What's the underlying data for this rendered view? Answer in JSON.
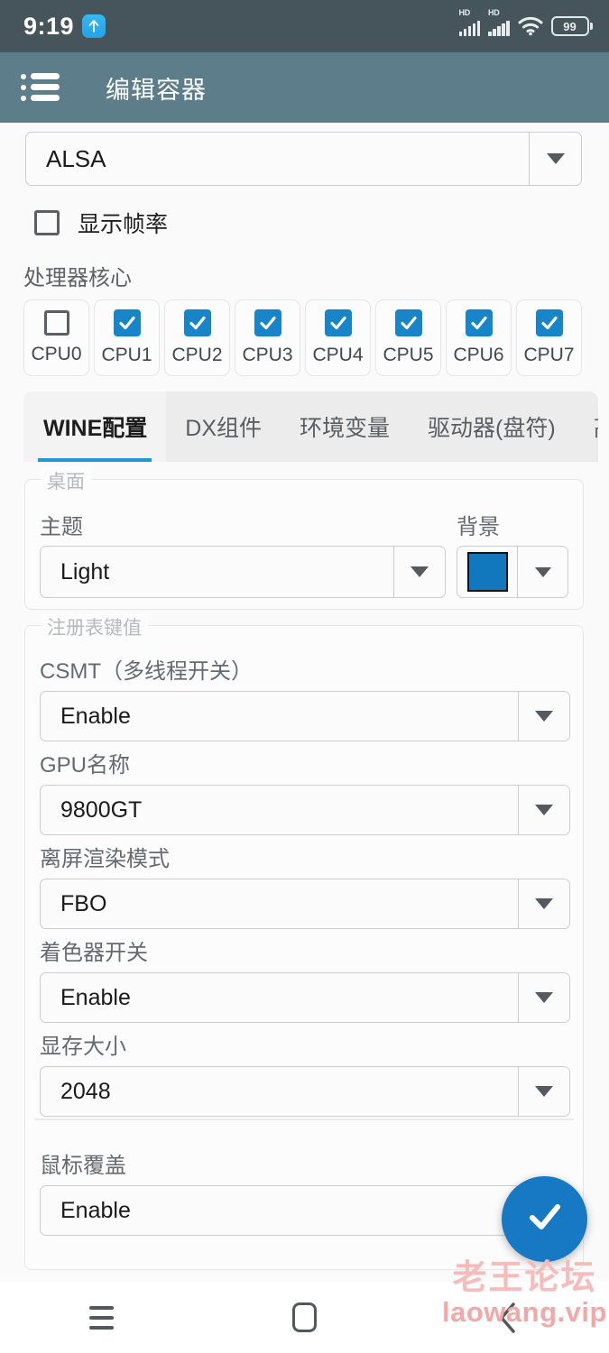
{
  "status_bar": {
    "time": "9:19",
    "up_icon": "arrow-up-icon",
    "signal_label": "HD",
    "signal_label_2": "HD",
    "wifi_icon": "wifi-icon",
    "battery_level": "99"
  },
  "app_bar": {
    "menu_icon": "list-menu-icon",
    "title": "编辑容器"
  },
  "audio": {
    "label": "",
    "value": "ALSA",
    "arrow_icon": "chevron-down-icon"
  },
  "show_fps": {
    "label": "显示帧率",
    "checked": false
  },
  "cpu": {
    "heading": "处理器核心",
    "cores": [
      {
        "label": "CPU0",
        "checked": false
      },
      {
        "label": "CPU1",
        "checked": true
      },
      {
        "label": "CPU2",
        "checked": true
      },
      {
        "label": "CPU3",
        "checked": true
      },
      {
        "label": "CPU4",
        "checked": true
      },
      {
        "label": "CPU5",
        "checked": true
      },
      {
        "label": "CPU6",
        "checked": true
      },
      {
        "label": "CPU7",
        "checked": true
      }
    ]
  },
  "tabs": [
    {
      "label": "WINE配置",
      "active": true
    },
    {
      "label": "DX组件",
      "active": false
    },
    {
      "label": "环境变量",
      "active": false
    },
    {
      "label": "驱动器(盘符)",
      "active": false
    },
    {
      "label": "高",
      "active": false
    }
  ],
  "desktop_group": {
    "legend": "桌面",
    "theme_label": "主题",
    "theme_value": "Light",
    "background_label": "背景",
    "background_color": "#1278be"
  },
  "registry_group": {
    "legend": "注册表键值",
    "items": [
      {
        "label": "CSMT（多线程开关）",
        "value": "Enable"
      },
      {
        "label": "GPU名称",
        "value": "9800GT"
      },
      {
        "label": "离屏渲染模式",
        "value": "FBO"
      },
      {
        "label": "着色器开关",
        "value": "Enable"
      },
      {
        "label": "显存大小",
        "value": "2048"
      },
      {
        "label": "鼠标覆盖",
        "value": "Enable"
      }
    ]
  },
  "fab": {
    "icon": "check-icon",
    "color": "#1779c4"
  },
  "nav_bar": {
    "recents_icon": "menu-recents-icon",
    "home_icon": "home-square-icon",
    "back_icon": "chevron-left-icon"
  },
  "watermark": {
    "line1": "老王论坛",
    "line2": "laowang.vip"
  },
  "colors": {
    "status_bar": "#46545c",
    "app_bar": "#5d7d8a",
    "accent": "#1785c8",
    "tab_indicator": "#2196d6",
    "page_bg": "#fafafa"
  }
}
